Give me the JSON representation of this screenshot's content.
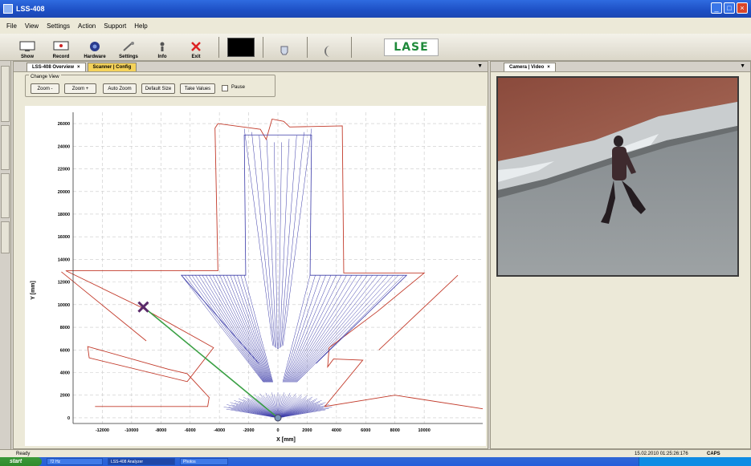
{
  "window": {
    "title": "LSS-408"
  },
  "menu": [
    "File",
    "View",
    "Settings",
    "Action",
    "Support",
    "Help"
  ],
  "toolbar": {
    "buttons": [
      {
        "label": "Show",
        "icon": "monitor-icon"
      },
      {
        "label": "Record",
        "icon": "record-icon"
      },
      {
        "label": "Hardware",
        "icon": "hardware-icon"
      },
      {
        "label": "Settings",
        "icon": "settings-icon"
      },
      {
        "label": "Info",
        "icon": "info-icon"
      },
      {
        "label": "Exit",
        "icon": "exit-icon"
      }
    ],
    "logo": "LASE"
  },
  "left_pane": {
    "tabs": [
      "LSS-408 Overview",
      "Scanner | Config"
    ],
    "change_view": {
      "legend": "Change View",
      "buttons": [
        "Zoom -",
        "Zoom +",
        "Auto Zoom",
        "Default Size",
        "Take Values"
      ],
      "pause_label": "Pause"
    }
  },
  "right_pane": {
    "tabs": [
      "Camera | Video"
    ]
  },
  "chart_data": {
    "type": "scatter",
    "xlabel": "X [mm]",
    "ylabel": "Y [mm]",
    "xlim": [
      -14000,
      14000
    ],
    "ylim": [
      -500,
      27000
    ],
    "x_ticks": [
      -12000,
      -10000,
      -8000,
      -6000,
      -4000,
      -2000,
      0,
      2000,
      4000,
      6000,
      8000,
      10000
    ],
    "y_ticks": [
      0,
      2000,
      4000,
      6000,
      8000,
      10000,
      12000,
      14000,
      16000,
      18000,
      20000,
      22000,
      24000,
      26000
    ],
    "grid": true,
    "scanner_origin": {
      "x": 0,
      "y": 0
    },
    "target": {
      "x": -9200,
      "y": 9800
    },
    "series": [
      {
        "color": "#3a3aa8",
        "points": [
          [
            -1200,
            24000
          ],
          [
            1200,
            24000
          ],
          [
            1400,
            25600
          ],
          [
            -1400,
            25600
          ],
          [
            -4800,
            12600
          ],
          [
            8800,
            12600
          ],
          [
            2400,
            5200
          ],
          [
            -2400,
            5200
          ]
        ]
      },
      {
        "color": "#c23a2a",
        "points": [
          [
            -4300,
            25400
          ],
          [
            -3900,
            12800
          ],
          [
            -14600,
            12800
          ],
          [
            -9200,
            7000
          ],
          [
            -6800,
            6200
          ],
          [
            -5900,
            4000
          ],
          [
            -4700,
            1800
          ],
          [
            -12500,
            800
          ],
          [
            3600,
            1000
          ],
          [
            7700,
            1600
          ],
          [
            12000,
            12400
          ],
          [
            4400,
            26400
          ]
        ]
      },
      {
        "color": "#3aa044",
        "points": [
          [
            0,
            0
          ],
          [
            -9200,
            9800
          ]
        ]
      }
    ]
  },
  "status": {
    "ready": "Ready",
    "timestamp": "15.02.2010 01:25:26:176",
    "caps": "CAPS"
  },
  "taskbar": {
    "start": "start",
    "items": [
      "72 Hz",
      "LSS-408 Analyzer",
      "Photos"
    ]
  },
  "colors": {
    "title_bar": "#1d4fc4",
    "scan_blue": "#3a3aa8",
    "contour_red": "#c23a2a",
    "target_line": "#3aa044",
    "target_marker": "#5a2a6a",
    "logo_green": "#1f8a3b"
  }
}
